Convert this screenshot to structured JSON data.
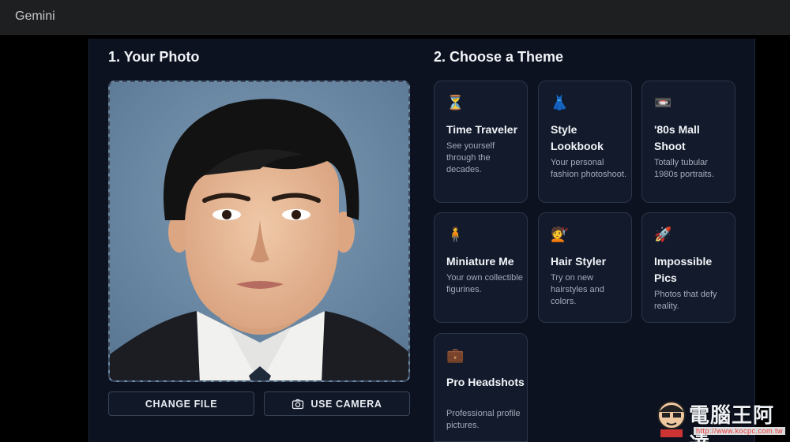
{
  "app": {
    "title": "Gemini"
  },
  "photo_section": {
    "title": "1. Your Photo",
    "change_file_label": "CHANGE FILE",
    "use_camera_label": "USE CAMERA"
  },
  "theme_section": {
    "title": "2. Choose a Theme",
    "themes": [
      {
        "emoji": "⏳",
        "name": "Time Traveler",
        "desc": "See yourself through the decades."
      },
      {
        "emoji": "👗",
        "name": "Style Lookbook",
        "desc": "Your personal fashion photoshoot."
      },
      {
        "emoji": "📼",
        "name": "'80s Mall Shoot",
        "desc": "Totally tubular 1980s portraits."
      },
      {
        "emoji": "🧍",
        "name": "Miniature Me",
        "desc": "Your own collectible figurines."
      },
      {
        "emoji": "💇",
        "name": "Hair Styler",
        "desc": "Try on new hairstyles and colors."
      },
      {
        "emoji": "🚀",
        "name": "Impossible Pics",
        "desc": "Photos that defy reality."
      },
      {
        "emoji": "💼",
        "name": "Pro Headshots",
        "desc": "Professional profile pictures."
      }
    ]
  },
  "watermark": {
    "text": "電腦王阿達",
    "url": "http://www.kocpc.com.tw"
  }
}
